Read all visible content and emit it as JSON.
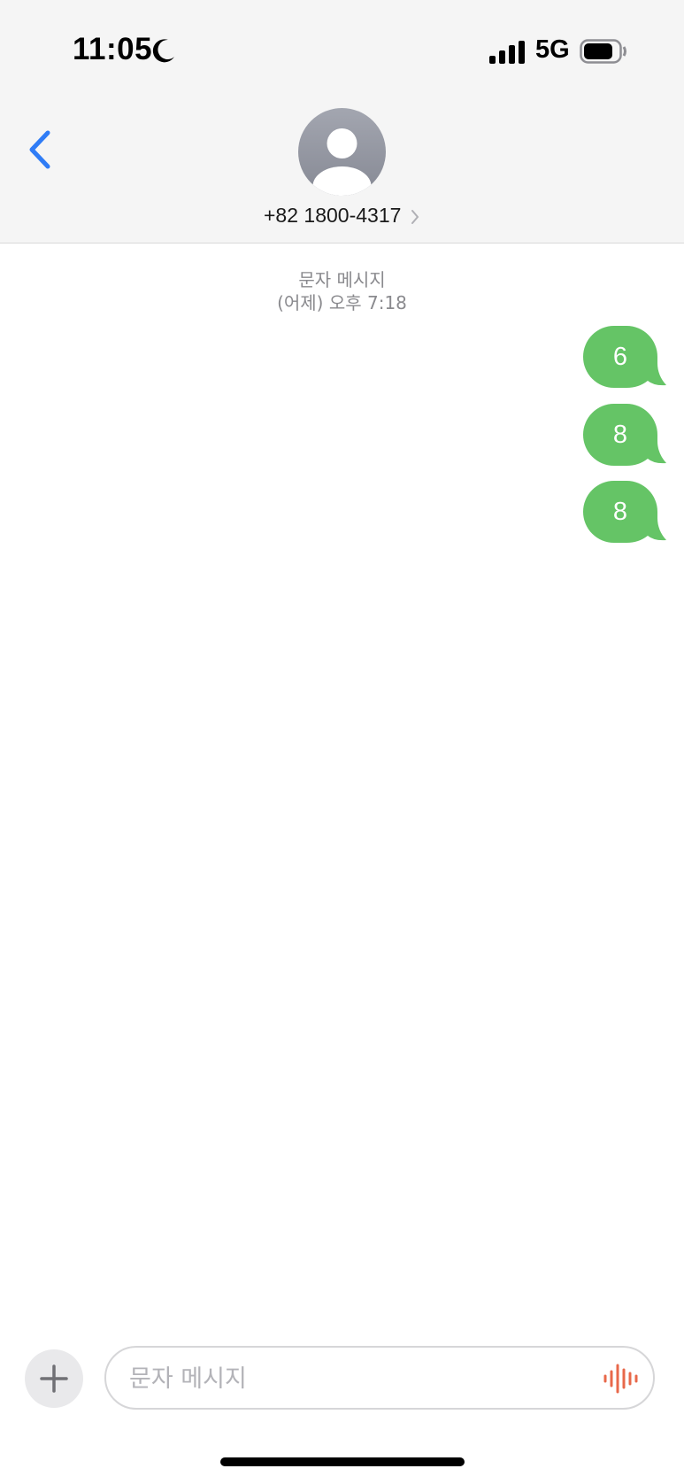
{
  "status_bar": {
    "time": "11:05",
    "network": "5G",
    "icons": [
      "moon-icon",
      "signal-icon",
      "battery-icon"
    ]
  },
  "header": {
    "back_icon": "chevron-left-icon",
    "avatar_icon": "person-silhouette-icon",
    "contact": "+82 1800-4317",
    "contact_chevron": "chevron-right-icon"
  },
  "thread": {
    "message_kind": "문자 메시지",
    "timestamp": "(어제) 오후 7:18",
    "messages": [
      {
        "text": "6",
        "direction": "outgoing"
      },
      {
        "text": "8",
        "direction": "outgoing"
      },
      {
        "text": "8",
        "direction": "outgoing"
      }
    ]
  },
  "composer": {
    "plus_icon": "plus-icon",
    "placeholder": "문자 메시지",
    "mic_icon": "audio-waveform-icon"
  },
  "colors": {
    "bubble_green": "#65c466",
    "accent_blue": "#2f7cf6",
    "mic_orange": "#e8684a",
    "header_bg": "#f5f5f5"
  }
}
